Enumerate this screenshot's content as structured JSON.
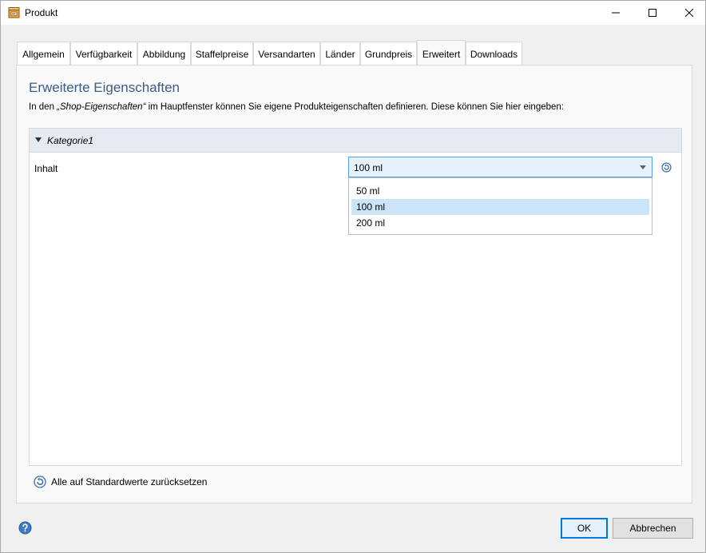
{
  "window": {
    "title": "Produkt"
  },
  "tabs": [
    {
      "label": "Allgemein",
      "name": "tab-allgemein"
    },
    {
      "label": "Verfügbarkeit",
      "name": "tab-verfuegbarkeit"
    },
    {
      "label": "Abbildung",
      "name": "tab-abbildung"
    },
    {
      "label": "Staffelpreise",
      "name": "tab-staffelpreise"
    },
    {
      "label": "Versandarten",
      "name": "tab-versandarten"
    },
    {
      "label": "Länder",
      "name": "tab-laender"
    },
    {
      "label": "Grundpreis",
      "name": "tab-grundpreis"
    },
    {
      "label": "Erweitert",
      "name": "tab-erweitert",
      "active": true
    },
    {
      "label": "Downloads",
      "name": "tab-downloads"
    }
  ],
  "panel": {
    "title": "Erweiterte Eigenschaften",
    "desc_prefix": "In den ",
    "desc_emphasis": "„Shop-Eigenschaften“",
    "desc_suffix": " im Hauptfenster können Sie eigene Produkteigenschaften definieren. Diese können Sie hier eingeben:"
  },
  "category": {
    "label": "Kategorie1"
  },
  "property": {
    "label": "Inhalt",
    "value": "100 ml",
    "options": [
      "50 ml",
      "100 ml",
      "200 ml"
    ],
    "selected_index": 1
  },
  "reset_all": {
    "label": "Alle auf Standardwerte zurücksetzen"
  },
  "buttons": {
    "ok": "OK",
    "cancel": "Abbrechen"
  },
  "colors": {
    "accent": "#0078d7",
    "section_title": "#3b5c85",
    "category_header": "#e6ebf3",
    "selected_item": "#cce4f7"
  }
}
